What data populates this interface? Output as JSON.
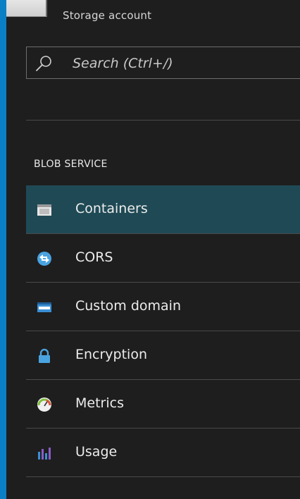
{
  "header": {
    "subtitle": "Storage account",
    "icon": "storage-account-icon"
  },
  "search": {
    "placeholder": "Search (Ctrl+/)",
    "icon": "search-icon"
  },
  "section": {
    "title": "BLOB SERVICE"
  },
  "menu": {
    "items": [
      {
        "label": "Containers",
        "icon": "containers-icon",
        "selected": true
      },
      {
        "label": "CORS",
        "icon": "cors-icon",
        "selected": false
      },
      {
        "label": "Custom domain",
        "icon": "custom-domain-icon",
        "selected": false
      },
      {
        "label": "Encryption",
        "icon": "lock-icon",
        "selected": false
      },
      {
        "label": "Metrics",
        "icon": "metrics-icon",
        "selected": false
      },
      {
        "label": "Usage",
        "icon": "usage-icon",
        "selected": false
      }
    ]
  },
  "colors": {
    "background": "#1e1e1e",
    "border": "#0a7fc6",
    "selected": "#1f4a55",
    "divider": "#4a4a4a",
    "text": "#ececec"
  }
}
